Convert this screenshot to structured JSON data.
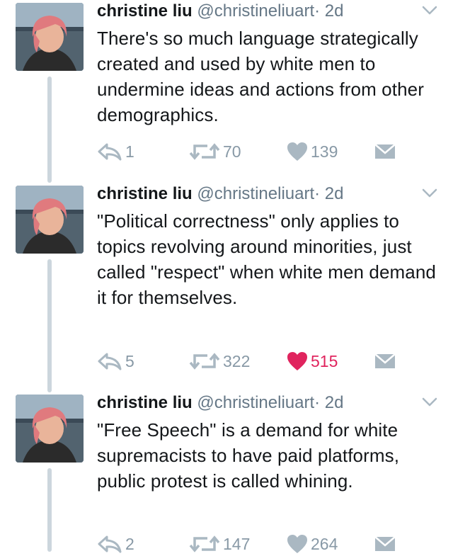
{
  "tweets": [
    {
      "name": "christine liu",
      "handle": "@christineliuart",
      "dot": "·",
      "time": "2d",
      "text": "There's so much language strategically created and used by white men to undermine ideas and actions from other demographics.",
      "replies": "1",
      "retweets": "70",
      "likes": "139",
      "liked": false
    },
    {
      "name": "christine liu",
      "handle": "@christineliuart",
      "dot": "·",
      "time": "2d",
      "text": "\"Political correctness\" only applies to topics revolving around minorities, just called \"respect\" when white men demand it for themselves.",
      "replies": "5",
      "retweets": "322",
      "likes": "515",
      "liked": true
    },
    {
      "name": "christine liu",
      "handle": "@christineliuart",
      "dot": "·",
      "time": "2d",
      "text": "\"Free Speech\" is a demand for white supremacists to have paid platforms, public protest is called whining.",
      "replies": "2",
      "retweets": "147",
      "likes": "264",
      "liked": false
    }
  ],
  "colors": {
    "icon_gray": "#aab8c2",
    "liked_red": "#e0245e",
    "thread_line": "#ccd6dd"
  },
  "icons": [
    "reply-icon",
    "retweet-icon",
    "heart-icon",
    "direct-message-icon",
    "chevron-down-icon"
  ]
}
